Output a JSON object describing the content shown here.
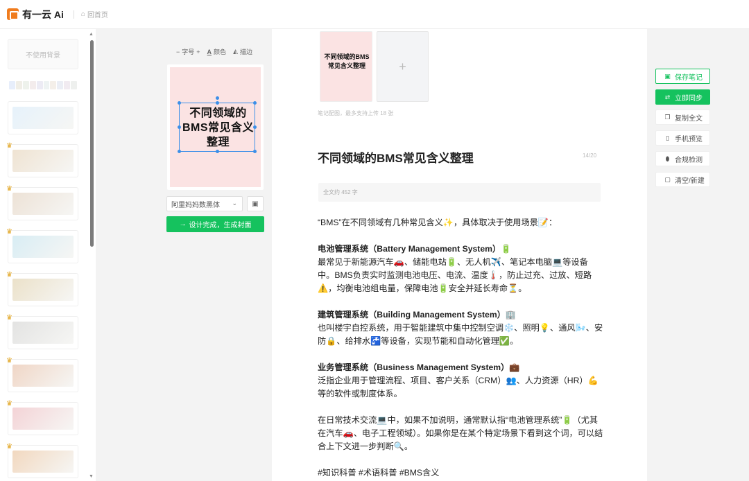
{
  "app": {
    "logo_text": "有一云 Ai",
    "home_label": "回首页"
  },
  "backgrounds": {
    "none_label": "不使用背景",
    "swatch_strip": [
      "#e7eefb",
      "#f0eee7",
      "#eef2ec",
      "#f3ecec",
      "#ecebf4",
      "#eef3f3",
      "#f4efe9",
      "#ebeef5",
      "#f1ebf1",
      "#eef0ee"
    ],
    "items": [
      {
        "color": "#e6f2fb",
        "premium": false
      },
      {
        "color": "#efe3d2",
        "premium": true
      },
      {
        "color": "#ede2d6",
        "premium": true
      },
      {
        "color": "#d8edf4",
        "premium": true
      },
      {
        "color": "#ebe1c9",
        "premium": true
      },
      {
        "color": "#e3e3e2",
        "premium": true
      },
      {
        "color": "#f0d6c6",
        "premium": true
      },
      {
        "color": "#f4d3d6",
        "premium": true
      },
      {
        "color": "#f2d8bf",
        "premium": true
      }
    ]
  },
  "editor": {
    "tools": {
      "font_size": "字号",
      "color": "颜色",
      "stroke": "描边"
    },
    "cover_title": "不同领域的BMS常见含义整理",
    "font_name": "阿里妈妈数黑体",
    "generate_label": "设计完成，生成封面"
  },
  "note": {
    "thumb_title": "不同领域的BMS常见含义整理",
    "image_hint": "笔记配图，最多支持上传 18 张",
    "title": "不同领域的BMS常见含义整理",
    "title_count": "14/20",
    "word_count": "全文约 452 字",
    "intro": "“BMS”在不同领域有几种常见含义✨，具体取决于使用场景📝：",
    "s1_heading": "电池管理系统（Battery Management System）🔋",
    "s1_body": "最常见于新能源汽车🚗、储能电站🔋、无人机✈️、笔记本电脑💻等设备中。BMS负责实时监测电池电压、电流、温度🌡️，防止过充、过放、短路⚠️，均衡电池组电量，保障电池🔋安全并延长寿命⏳。",
    "s2_heading": "建筑管理系统（Building Management System）🏢",
    "s2_body": "也叫楼宇自控系统，用于智能建筑中集中控制空调❄️、照明💡、通风🌬️、安防🔒、给排水🚰等设备，实现节能和自动化管理✅。",
    "s3_heading": "业务管理系统（Business Management System）💼",
    "s3_body": "泛指企业用于管理流程、项目、客户关系（CRM）👥、人力资源（HR）💪等的软件或制度体系。",
    "summary": "在日常技术交流💻中，如果不加说明，通常默认指“电池管理系统”🔋（尤其在汽车🚗、电子工程领域）。如果你是在某个特定场景下看到这个词，可以结合上下文进一步判断🔍。",
    "tags": "#知识科普 #术语科普 #BMS含义"
  },
  "actions": {
    "save": "保存笔记",
    "sync": "立即同步",
    "copy": "复制全文",
    "preview": "手机预览",
    "check": "合规检测",
    "clear": "清空/新建"
  },
  "colors": {
    "accent": "#15c25e",
    "cover_bg": "#fbe3e3",
    "selection": "#3b8fe8"
  }
}
